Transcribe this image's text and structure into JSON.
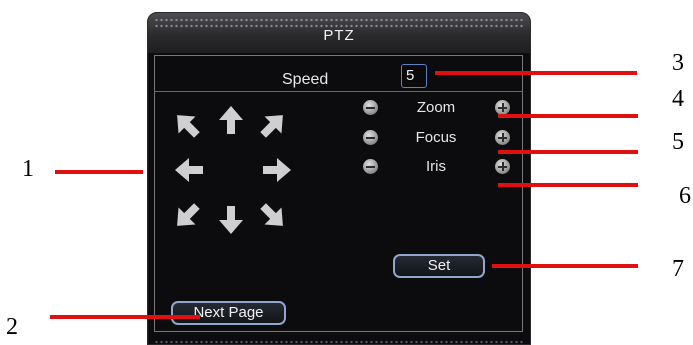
{
  "window": {
    "title": "PTZ"
  },
  "speed": {
    "label": "Speed",
    "value": "5"
  },
  "direction_pad": {
    "arrows": [
      "up-left",
      "up",
      "up-right",
      "left",
      "right",
      "down-left",
      "down",
      "down-right"
    ]
  },
  "lens_controls": [
    {
      "label": "Zoom"
    },
    {
      "label": "Focus"
    },
    {
      "label": "Iris"
    }
  ],
  "buttons": {
    "set": "Set",
    "next_page": "Next Page"
  },
  "callouts": [
    "1",
    "2",
    "3",
    "4",
    "5",
    "6",
    "7"
  ],
  "colors": {
    "callout_line": "#e01010",
    "panel_bg": "#0c0c0e",
    "accent": "#5a82c7"
  }
}
